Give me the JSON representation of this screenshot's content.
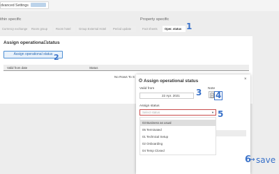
{
  "breadcrumb": {
    "text": "dvanced Settings"
  },
  "sections": {
    "left": "ithin specific",
    "right": "Property specific"
  },
  "tabs": [
    {
      "label": "Currency exchange"
    },
    {
      "label": "Room group"
    },
    {
      "label": "Room hotel"
    },
    {
      "label": "Group External Hotel"
    },
    {
      "label": "Period update"
    },
    {
      "label": "Fact sheets"
    },
    {
      "label": "Oper. status"
    }
  ],
  "panel": {
    "title": "Assign operational status",
    "info_icon": "info-icon",
    "assign_button": "Assign operational status"
  },
  "table": {
    "columns": [
      "Valid from date",
      "Status"
    ],
    "empty_text": "No Rows To S"
  },
  "dialog": {
    "title": "Assign operational status",
    "title_icon": "circle-i-icon",
    "close_label": "×",
    "valid_from_label": "Valid from",
    "valid_from_value": "22 Apr. 2021",
    "note_label": "Note",
    "note_icon": "document-icon",
    "assign_status_label": "Assign status",
    "select_placeholder": "Select status",
    "options": [
      "03 Business as usual",
      "05 Terminated",
      "01 Technical Setup",
      "02 Onboarding",
      "04 Temp Closed"
    ],
    "selected_option_index": 0
  },
  "annotations": {
    "n1": "1",
    "n2": "2",
    "n3": "3",
    "n4": "4",
    "n5": "5",
    "n6": "6",
    "save": "save",
    "arrow": "→"
  },
  "colors": {
    "accent": "#3a72c9",
    "button_border": "#4e8fd3",
    "error_border": "#c84b4b"
  }
}
